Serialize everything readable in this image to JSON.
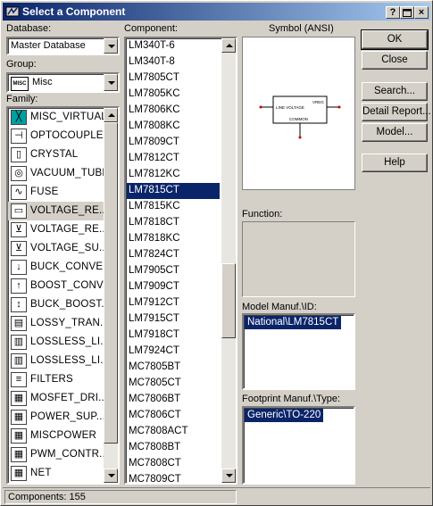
{
  "window": {
    "title": "Select a Component",
    "help_button": "?",
    "minimize_button": "_",
    "maximize_button": "□",
    "close_button": "×"
  },
  "database": {
    "label": "Database:",
    "selected": "Master Database"
  },
  "group": {
    "label": "Group:",
    "icon_text": "MISC",
    "selected": "Misc"
  },
  "family": {
    "label": "Family:",
    "selected_index": 5,
    "items": [
      {
        "label": "MISC_VIRTUAL",
        "icon": "misc-virtual-icon",
        "glyph": "╳"
      },
      {
        "label": "OPTOCOUPLER",
        "icon": "optocoupler-icon",
        "glyph": "⊣"
      },
      {
        "label": "CRYSTAL",
        "icon": "crystal-icon",
        "glyph": "▯"
      },
      {
        "label": "VACUUM_TUBE",
        "icon": "vacuum-tube-icon",
        "glyph": "◎"
      },
      {
        "label": "FUSE",
        "icon": "fuse-icon",
        "glyph": "∿"
      },
      {
        "label": "VOLTAGE_RE...",
        "icon": "voltage-regulator-icon",
        "glyph": "▭"
      },
      {
        "label": "VOLTAGE_RE...",
        "icon": "voltage-reference-icon",
        "glyph": "⊻"
      },
      {
        "label": "VOLTAGE_SU...",
        "icon": "voltage-suppressor-icon",
        "glyph": "⊻"
      },
      {
        "label": "BUCK_CONVE...",
        "icon": "buck-converter-icon",
        "glyph": "↓"
      },
      {
        "label": "BOOST_CONV...",
        "icon": "boost-converter-icon",
        "glyph": "↑"
      },
      {
        "label": "BUCK_BOOST...",
        "icon": "buck-boost-icon",
        "glyph": "↕"
      },
      {
        "label": "LOSSY_TRAN...",
        "icon": "lossy-transmission-icon",
        "glyph": "▤"
      },
      {
        "label": "LOSSLESS_LI...",
        "icon": "lossless-line-icon",
        "glyph": "▥"
      },
      {
        "label": "LOSSLESS_LI...",
        "icon": "lossless-line-2-icon",
        "glyph": "▥"
      },
      {
        "label": "FILTERS",
        "icon": "filters-icon",
        "glyph": "≡"
      },
      {
        "label": "MOSFET_DRI...",
        "icon": "mosfet-driver-icon",
        "glyph": "▦"
      },
      {
        "label": "POWER_SUP...",
        "icon": "power-supply-icon",
        "glyph": "▦"
      },
      {
        "label": "MISCPOWER",
        "icon": "miscpower-icon",
        "glyph": "▦"
      },
      {
        "label": "PWM_CONTR...",
        "icon": "pwm-controller-icon",
        "glyph": "▦"
      },
      {
        "label": "NET",
        "icon": "net-icon",
        "glyph": "▦"
      }
    ]
  },
  "component": {
    "label": "Component:",
    "selected_index": 9,
    "items": [
      "LM340T-6",
      "LM340T-8",
      "LM7805CT",
      "LM7805KC",
      "LM7806KC",
      "LM7808KC",
      "LM7809CT",
      "LM7812CT",
      "LM7812KC",
      "LM7815CT",
      "LM7815KC",
      "LM7818CT",
      "LM7818KC",
      "LM7824CT",
      "LM7905CT",
      "LM7909CT",
      "LM7912CT",
      "LM7915CT",
      "LM7918CT",
      "LM7924CT",
      "MC7805BT",
      "MC7805CT",
      "MC7806BT",
      "MC7806CT",
      "MC7808ACT",
      "MC7808BT",
      "MC7808CT",
      "MC7809CT"
    ]
  },
  "symbol": {
    "label": "Symbol (ANSI)",
    "pin_in": "LINE VOLTAGE",
    "pin_out": "VREG",
    "pin_common": "COMMON"
  },
  "function": {
    "label": "Function:"
  },
  "model": {
    "label": "Model Manuf.\\ID:",
    "selected": "National\\LM7815CT"
  },
  "footprint": {
    "label": "Footprint Manuf.\\Type:",
    "selected": "Generic\\TO-220"
  },
  "buttons": {
    "ok": "OK",
    "close": "Close",
    "search": "Search...",
    "detail_report": "Detail Report...",
    "model": "Model...",
    "help": "Help"
  },
  "status": {
    "text": "Components: 155"
  },
  "colors": {
    "title_gradient_start": "#0a246a",
    "title_gradient_end": "#a6caf0",
    "selection": "#0a246a",
    "face": "#d4d0c8",
    "icon_accent": "#00a0a0"
  }
}
